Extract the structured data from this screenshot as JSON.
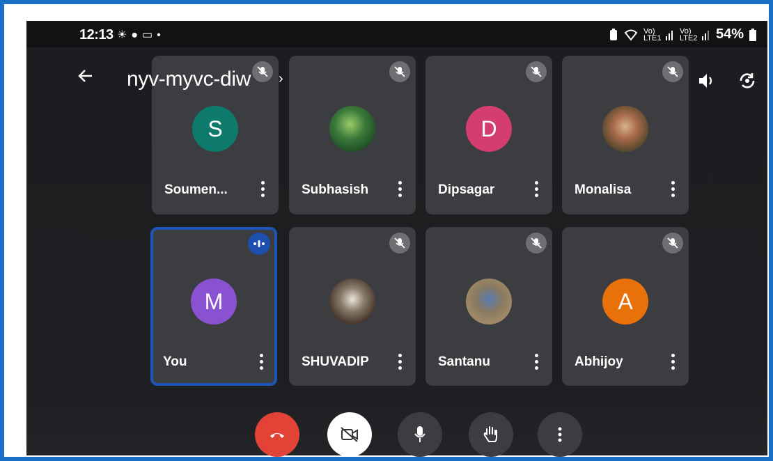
{
  "status_bar": {
    "time": "12:13",
    "left_icons": [
      "weather-icon",
      "account-icon",
      "cast-icon"
    ],
    "dot": "•",
    "network_1": "Vo) LTE1",
    "network_2": "Vo) LTE2",
    "battery": "54%"
  },
  "top_bar": {
    "back_icon": "arrow-left-icon",
    "meeting_code": "nyv-myvc-diw",
    "chevron": "›",
    "speaker_icon": "speaker-icon",
    "camera_switch_icon": "camera-switch-icon"
  },
  "participants": [
    {
      "name": "Soumen...",
      "avatar_letter": "S",
      "avatar_color": "#0d7a6b",
      "muted": true
    },
    {
      "name": "Subhasish",
      "avatar_letter": "",
      "avatar_color": "#2f6b3a",
      "muted": true,
      "photo": true
    },
    {
      "name": "Dipsagar",
      "avatar_letter": "D",
      "avatar_color": "#d43e6e",
      "muted": true
    },
    {
      "name": "Monalisa",
      "avatar_letter": "",
      "avatar_color": "#7a5a3a",
      "muted": true,
      "photo": true
    },
    {
      "name": "You",
      "avatar_letter": "M",
      "avatar_color": "#8a52d0",
      "muted": false,
      "speaking": true
    },
    {
      "name": "SHUVADIP",
      "avatar_letter": "",
      "avatar_color": "#5a4a3e",
      "muted": true,
      "photo": true
    },
    {
      "name": "Santanu",
      "avatar_letter": "",
      "avatar_color": "#6a6258",
      "muted": true,
      "photo": true
    },
    {
      "name": "Abhijoy",
      "avatar_letter": "A",
      "avatar_color": "#e8710a",
      "muted": true
    }
  ],
  "controls": [
    {
      "name": "end-call",
      "icon": "phone-hangup-icon",
      "color": "#e24336"
    },
    {
      "name": "camera-off",
      "icon": "camera-off-icon",
      "color": "#ffffff"
    },
    {
      "name": "microphone",
      "icon": "microphone-icon",
      "color": "#3c3d41"
    },
    {
      "name": "raise-hand",
      "icon": "hand-icon",
      "color": "#3c3d41"
    },
    {
      "name": "more-options",
      "icon": "more-vert-icon",
      "color": "#3c3d41"
    }
  ],
  "colors": {
    "screen_bg": "#111214",
    "tile_bg": "#3c3d41",
    "active_border": "#1d56b7",
    "outer_border": "#1b6fc4"
  }
}
